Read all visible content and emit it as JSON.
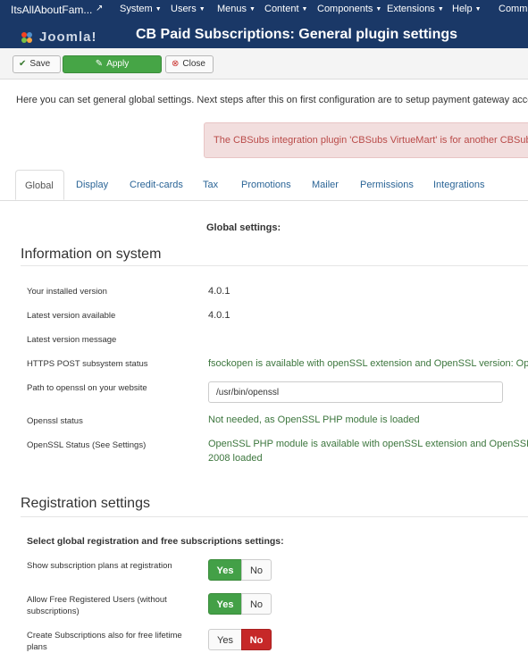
{
  "topbar": {
    "site": "ItsAllAboutFam...",
    "ext_icon": "external-link-icon",
    "menus": [
      "System",
      "Users",
      "Menus",
      "Content",
      "Components",
      "Extensions",
      "Help",
      "Commu"
    ]
  },
  "header": {
    "brand": "Joomla!",
    "title": "CB Paid Subscriptions: General plugin settings"
  },
  "toolbar": {
    "save_label": "Save",
    "apply_label": "Apply",
    "close_label": "Close"
  },
  "intro": "Here you can set general global settings. Next steps after this on first configuration are to setup payment gateway accounts",
  "alert": "The CBSubs integration plugin 'CBSubs VirtueMart' is for another CBSubs v",
  "tabs": [
    "Global",
    "Display",
    "Credit-cards",
    "Tax",
    "Promotions",
    "Mailer",
    "Permissions",
    "Integrations"
  ],
  "global_heading": "Global settings:",
  "info_section": {
    "title": "Information on system",
    "rows": [
      {
        "label": "Your installed version",
        "value": "4.0.1"
      },
      {
        "label": "Latest version available",
        "value": "4.0.1"
      },
      {
        "label": "Latest version message",
        "value": ""
      },
      {
        "label": "HTTPS POST subsystem status",
        "value": "fsockopen is available with openSSL extension and OpenSSL version: Open"
      },
      {
        "label": "Path to openssl on your website",
        "value": "/usr/bin/openssl"
      },
      {
        "label": "Openssl status",
        "value": "Not needed, as OpenSSL PHP module is loaded"
      },
      {
        "label": "OpenSSL Status (See Settings)",
        "value": "OpenSSL PHP module is available with openSSL extension and OpenSSL v",
        "value2": "2008 loaded"
      }
    ]
  },
  "registration_section": {
    "title": "Registration settings",
    "subheading": "Select global registration and free subscriptions settings:",
    "rows": [
      {
        "label": "Show subscription plans at registration",
        "yes": "Yes",
        "no": "No",
        "selected": "yes"
      },
      {
        "label": "Allow Free Registered Users (without subscriptions)",
        "yes": "Yes",
        "no": "No",
        "selected": "yes"
      },
      {
        "label": "Create Subscriptions also for free lifetime plans",
        "yes": "Yes",
        "no": "No",
        "selected": "no"
      }
    ]
  },
  "colors": {
    "navbar": "#1a3867",
    "apply": "#46a546",
    "alert_text": "#b94a48",
    "yes_on": "#43a047",
    "no_on": "#c62828",
    "link": "#2a6496"
  }
}
